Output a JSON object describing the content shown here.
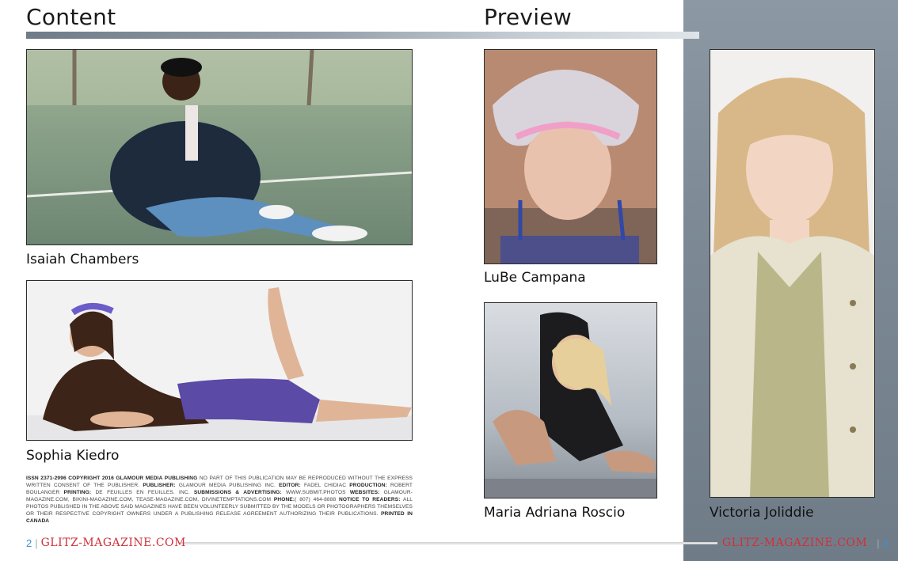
{
  "headings": {
    "content": "Content",
    "preview": "Preview"
  },
  "captions": {
    "isaiah": "Isaiah Chambers",
    "sophia": "Sophia Kiedro",
    "lube": "LuBe Campana",
    "maria": "Maria Adriana Roscio",
    "victoria": "Victoria Joliddie"
  },
  "imprint": {
    "issn_label": "ISSN 2371-2996 COPYRIGHT 2016 GLAMOUR MEDIA PUBLISHING",
    "t1": " NO PART OF THIS PUBLICATION MAY BE REPRODUCED WITHOUT THE EXPRESS WRITTEN CONSENT OF THE PUBLISHER. ",
    "publisher_label": "PUBLISHER:",
    "t2": " GLAMOUR MEDIA PUBLISHING INC. ",
    "editor_label": "EDITOR:",
    "t3": " FADEL CHIDIAC ",
    "production_label": "PRODUCTION:",
    "t4": " ROBERT BOULANGER ",
    "printing_label": "PRINTING:",
    "t5": " DE FEUILLES EN FEUILLES. INC. ",
    "submissions_label": "SUBMISSIONS & ADVERTISING:",
    "t6": " WWW.SUBMIT.PHOTOS ",
    "websites_label": "WEBSITES:",
    "t7": " GLAMOUR-MAGAZINE.COM, BIKINI-MAGAZINE.COM, TEASE-MAGAZINE.COM, DIVINETEMPTATIONS.COM ",
    "phone_label": "PHONE:",
    "t8": "( 807) 464-8888 ",
    "notice_label": "NOTICE TO READERS:",
    "t9": " ALL PHOTOS PUBLISHED IN THE ABOVE SAID MAGAZINES HAVE BEEN VOLUNTEERLY SUBMITTED BY THE MODELS OR PHOTOGRAPHERS THEMSELVES OR THEIR RESPECTIVE COPYRIGHT OWNERS UNDER A PUBLISHING RELEASE AGREEMENT AUTHORIZING THEIR PUBLICATIONS. ",
    "printed_label": "PRINTED IN CANADA"
  },
  "footer": {
    "left_page": "2",
    "right_page": "3",
    "separator": "|",
    "magazine": "GLITZ-MAGAZINE.COM"
  },
  "colors": {
    "panel": "#7d8a96",
    "page_number": "#3a8fd0",
    "brand": "#d0303a"
  }
}
